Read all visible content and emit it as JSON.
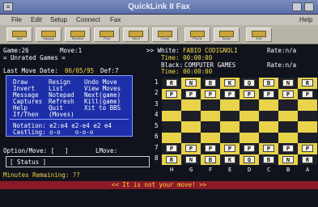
{
  "window": {
    "title": "QuickLink II Fax",
    "close_glyph": "≡"
  },
  "menubar": [
    "File",
    "Edit",
    "Setup",
    "Connect",
    "Fax",
    "Help"
  ],
  "toolbar": [
    "Dial",
    "Hangup",
    "Receive",
    "Print",
    "Send",
    "Cover",
    "Phone",
    "Setup",
    "Exit"
  ],
  "header": {
    "game": "Game:26",
    "move": "Move:1",
    "rated": "= Unrated Games =",
    "last_move_date_label": "Last Move Date:",
    "last_move_date": "06/05/95",
    "def": "Def:7"
  },
  "players": {
    "white_label": ">> White:",
    "white": "FABIO CODIGNOLI",
    "white_time": "Time: 00:00:00",
    "white_rate": "Rate:n/a",
    "black_label": "Black:",
    "black": "COMPUTER GAMES",
    "black_time": "Time: 00:00:00",
    "black_rate": "Rate:n/a"
  },
  "command_menu": {
    "rows": [
      [
        "Draw",
        "Resign",
        "Undo Move"
      ],
      [
        "Invert",
        "List",
        "View Moves"
      ],
      [
        "Message",
        "Notepad",
        "Next(game)"
      ],
      [
        "Captures",
        "Refresh",
        "Kill(game)"
      ],
      [
        "Help",
        "Quit",
        "Xit to BBS"
      ],
      [
        "If/Then",
        "(Moves)",
        ""
      ]
    ],
    "notation": "Notation: e2:e4 e2-e4 e2 e4",
    "castling": "Castling: o-o    o-o-o"
  },
  "option": {
    "label": "Option/Move: [",
    "close": "]",
    "lmove_label": "LMove:"
  },
  "status": "[ Status ]",
  "minutes": "Minutes Remaining: ??",
  "message": "<< It is not your move! >>",
  "board": {
    "ranks": [
      "1",
      "2",
      "3",
      "4",
      "5",
      "6",
      "7",
      "8"
    ],
    "files": [
      "H",
      "G",
      "F",
      "E",
      "D",
      "C",
      "B",
      "A"
    ],
    "rank1_pieces": [
      "R",
      "N",
      "B",
      "K",
      "Q",
      "B",
      "N",
      "R"
    ],
    "rank2_pieces": [
      "P",
      "P",
      "P",
      "P",
      "P",
      "P",
      "P",
      "P"
    ],
    "rank7_pieces": [
      "P",
      "P",
      "P",
      "P",
      "P",
      "P",
      "P",
      "P"
    ],
    "rank8_pieces": [
      "R",
      "N",
      "B",
      "K",
      "Q",
      "B",
      "N",
      "R"
    ]
  }
}
